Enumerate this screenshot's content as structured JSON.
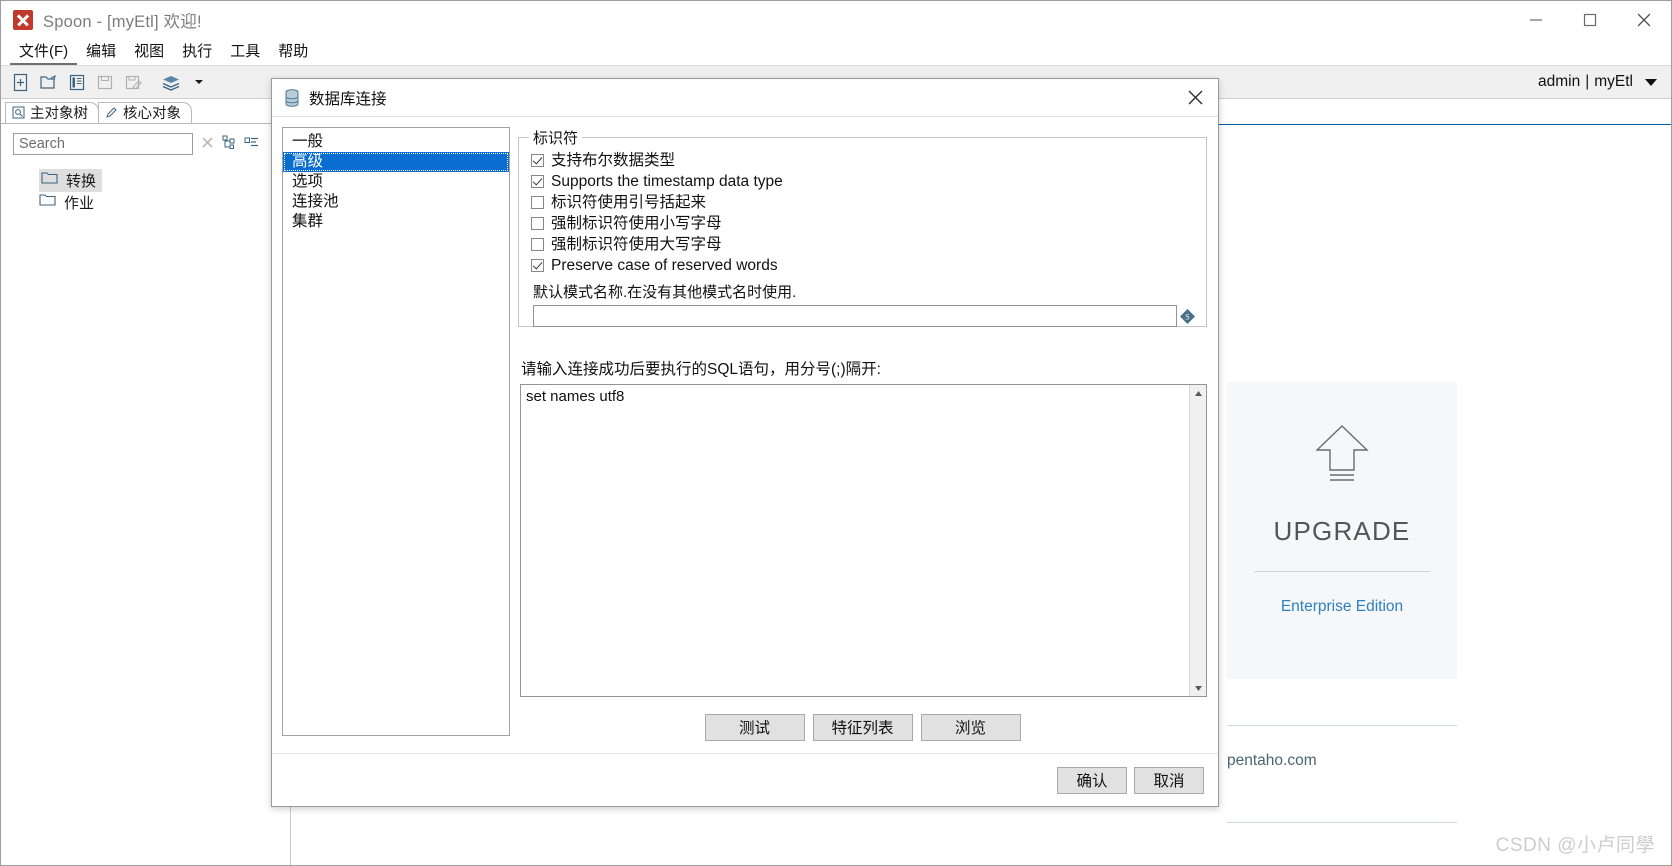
{
  "window": {
    "title": "Spoon - [myEtl] 欢迎!",
    "app_icon": "spoon-logo-icon",
    "controls": {
      "minimize": "minimize-icon",
      "maximize": "maximize-icon",
      "close": "close-icon"
    }
  },
  "menubar": {
    "items": [
      {
        "label": "文件(F)",
        "mnemonic": "F"
      },
      {
        "label": "编辑"
      },
      {
        "label": "视图"
      },
      {
        "label": "执行"
      },
      {
        "label": "工具"
      },
      {
        "label": "帮助"
      }
    ]
  },
  "toolbar": {
    "icons": [
      "new-file-icon",
      "open-folder-icon",
      "explore-icon",
      "save-icon",
      "save-as-icon",
      "layers-icon",
      "dropdown-caret-icon"
    ],
    "user": {
      "name": "admin",
      "separator": "|",
      "repository": "myEtl",
      "caret": "chevron-down-icon"
    }
  },
  "sidebar": {
    "tabs": [
      {
        "label": "主对象树",
        "icon": "tree-view-icon",
        "active": true
      },
      {
        "label": "核心对象",
        "icon": "pencil-icon",
        "active": false
      }
    ],
    "search": {
      "placeholder": "Search",
      "value": "",
      "clear_icon": "clear-x-icon",
      "expand_all_icon": "expand-all-icon",
      "collapse_all_icon": "collapse-all-icon"
    },
    "tree": [
      {
        "label": "转换",
        "icon": "folder-icon",
        "selected": true
      },
      {
        "label": "作业",
        "icon": "folder-icon",
        "selected": false
      }
    ]
  },
  "welcome": {
    "upgrade_card": {
      "icon": "upgrade-arrow-icon",
      "title": "UPGRADE",
      "link": "Enterprise Edition"
    },
    "site_link": "pentaho.com",
    "watermark": "CSDN @小卢同學"
  },
  "dialog": {
    "title": "数据库连接",
    "icon": "database-icon",
    "close_icon": "close-icon",
    "nav": [
      {
        "label": "一般",
        "selected": false
      },
      {
        "label": "高级",
        "selected": true
      },
      {
        "label": "选项",
        "selected": false
      },
      {
        "label": "连接池",
        "selected": false
      },
      {
        "label": "集群",
        "selected": false
      }
    ],
    "identifier_group": {
      "legend": "标识符",
      "checkboxes": [
        {
          "label": "支持布尔数据类型",
          "checked": true
        },
        {
          "label": "Supports the timestamp data type",
          "checked": true
        },
        {
          "label": "标识符使用引号括起来",
          "checked": false
        },
        {
          "label": "强制标识符使用小写字母",
          "checked": false
        },
        {
          "label": "强制标识符使用大写字母",
          "checked": false
        },
        {
          "label": "Preserve case of reserved words",
          "checked": true
        }
      ],
      "schema_hint": "默认模式名称.在没有其他模式名时使用.",
      "schema_value": "",
      "schema_variable_icon": "variable-diamond-icon"
    },
    "sql": {
      "label": "请输入连接成功后要执行的SQL语句，用分号(;)隔开:",
      "value": "set names utf8",
      "scroll_up_icon": "scroll-up-icon",
      "scroll_down_icon": "scroll-down-icon"
    },
    "action_buttons": [
      {
        "label": "测试",
        "name": "test-button"
      },
      {
        "label": "特征列表",
        "name": "feature-list-button"
      },
      {
        "label": "浏览",
        "name": "explore-button"
      }
    ],
    "footer_buttons": [
      {
        "label": "确认",
        "name": "ok-button"
      },
      {
        "label": "取消",
        "name": "cancel-button"
      }
    ]
  },
  "colors": {
    "accent_blue": "#0a6ed1",
    "tab_underline": "#005da3",
    "toolbar_icon": "#3c6382",
    "link_blue": "#2f7fc1"
  }
}
